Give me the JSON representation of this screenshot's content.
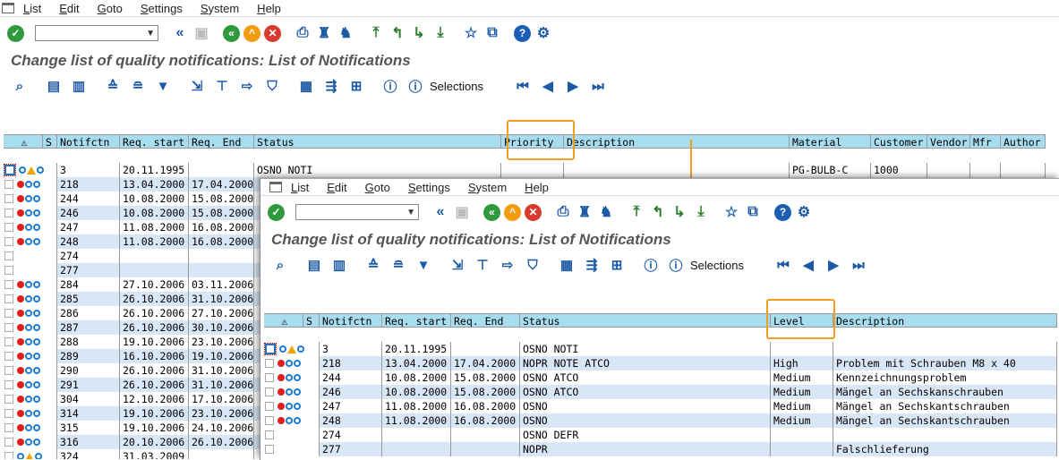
{
  "menu": [
    "List",
    "Edit",
    "Goto",
    "Settings",
    "System",
    "Help"
  ],
  "title": "Change list of quality notifications: List of Notifications",
  "selections_label": "Selections",
  "back_table": {
    "headers": [
      "⚠",
      "S",
      "Notifctn",
      "Req. start",
      "Req. End",
      "Status",
      "Priority",
      "Description",
      "Material",
      "Customer",
      "Vendor",
      "Mfr",
      "Author"
    ],
    "rows": [
      {
        "icons": "ayb",
        "notif": "3",
        "start": "20.11.1995",
        "end": "",
        "status": "OSNO NOTI",
        "material": "PG-BULB-C",
        "customer": "1000"
      },
      {
        "icons": "rbb",
        "notif": "218",
        "start": "13.04.2000",
        "end": "17.04.2000"
      },
      {
        "icons": "rbb",
        "notif": "244",
        "start": "10.08.2000",
        "end": "15.08.2000"
      },
      {
        "icons": "rbb",
        "notif": "246",
        "start": "10.08.2000",
        "end": "15.08.2000"
      },
      {
        "icons": "rbb",
        "notif": "247",
        "start": "11.08.2000",
        "end": "16.08.2000"
      },
      {
        "icons": "rbb",
        "notif": "248",
        "start": "11.08.2000",
        "end": "16.08.2000"
      },
      {
        "icons": "",
        "notif": "274",
        "start": "",
        "end": ""
      },
      {
        "icons": "",
        "notif": "277",
        "start": "",
        "end": ""
      },
      {
        "icons": "rbb",
        "notif": "284",
        "start": "27.10.2006",
        "end": "03.11.2006"
      },
      {
        "icons": "rbb",
        "notif": "285",
        "start": "26.10.2006",
        "end": "31.10.2006"
      },
      {
        "icons": "rbb",
        "notif": "286",
        "start": "26.10.2006",
        "end": "27.10.2006"
      },
      {
        "icons": "rbb",
        "notif": "287",
        "start": "26.10.2006",
        "end": "30.10.2006"
      },
      {
        "icons": "rbb",
        "notif": "288",
        "start": "19.10.2006",
        "end": "23.10.2006"
      },
      {
        "icons": "rbb",
        "notif": "289",
        "start": "16.10.2006",
        "end": "19.10.2006"
      },
      {
        "icons": "rbb",
        "notif": "290",
        "start": "26.10.2006",
        "end": "31.10.2006"
      },
      {
        "icons": "rbb",
        "notif": "291",
        "start": "26.10.2006",
        "end": "31.10.2006"
      },
      {
        "icons": "rbb",
        "notif": "304",
        "start": "12.10.2006",
        "end": "17.10.2006"
      },
      {
        "icons": "rbb",
        "notif": "314",
        "start": "19.10.2006",
        "end": "23.10.2006"
      },
      {
        "icons": "rbb",
        "notif": "315",
        "start": "19.10.2006",
        "end": "24.10.2006"
      },
      {
        "icons": "rbb",
        "notif": "316",
        "start": "20.10.2006",
        "end": "26.10.2006"
      },
      {
        "icons": "ayb",
        "notif": "324",
        "start": "31.03.2009",
        "end": ""
      }
    ]
  },
  "front_table": {
    "headers": [
      "⚠",
      "S",
      "Notifctn",
      "Req. start",
      "Req. End",
      "Status",
      "Level",
      "Description"
    ],
    "rows": [
      {
        "icons": "ayb",
        "notif": "3",
        "start": "20.11.1995",
        "end": "",
        "status": "OSNO NOTI",
        "level": "",
        "desc": ""
      },
      {
        "icons": "rbb",
        "notif": "218",
        "start": "13.04.2000",
        "end": "17.04.2000",
        "status": "NOPR NOTE ATCO",
        "level": "High",
        "desc": "Problem mit Schrauben M8 x 40"
      },
      {
        "icons": "rbb",
        "notif": "244",
        "start": "10.08.2000",
        "end": "15.08.2000",
        "status": "OSNO ATCO",
        "level": "Medium",
        "desc": "Kennzeichnungsproblem"
      },
      {
        "icons": "rbb",
        "notif": "246",
        "start": "10.08.2000",
        "end": "15.08.2000",
        "status": "OSNO ATCO",
        "level": "Medium",
        "desc": "Mängel an Sechskanschrauben"
      },
      {
        "icons": "rbb",
        "notif": "247",
        "start": "11.08.2000",
        "end": "16.08.2000",
        "status": "OSNO",
        "level": "Medium",
        "desc": "Mängel an Sechskantschrauben"
      },
      {
        "icons": "rbb",
        "notif": "248",
        "start": "11.08.2000",
        "end": "16.08.2000",
        "status": "OSNO",
        "level": "Medium",
        "desc": "Mängel an Sechskantschrauben"
      },
      {
        "icons": "",
        "notif": "274",
        "start": "",
        "end": "",
        "status": "OSNO DEFR",
        "level": "",
        "desc": ""
      },
      {
        "icons": "",
        "notif": "277",
        "start": "",
        "end": "",
        "status": "NOPR",
        "level": "",
        "desc": "Falschlieferung"
      }
    ]
  },
  "colors": {
    "header_bg": "#a8ddf0",
    "alt_row": "#d9e6f5",
    "highlight": "#f0a020"
  }
}
